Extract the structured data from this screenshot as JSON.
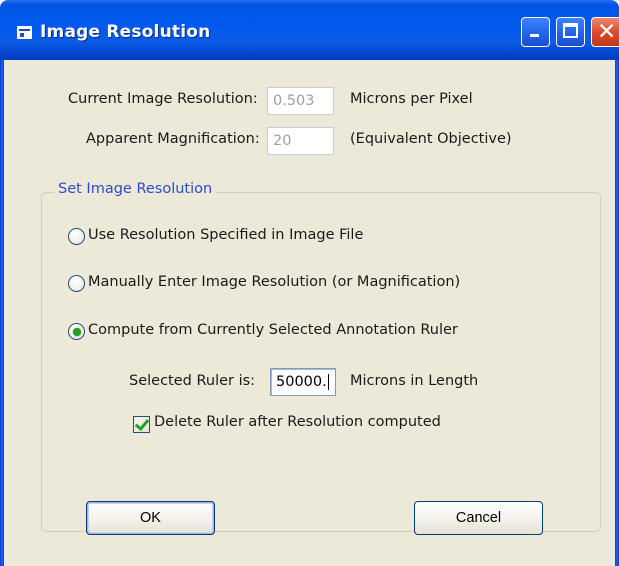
{
  "window": {
    "title": "Image Resolution"
  },
  "current": {
    "label": "Current Image Resolution:",
    "value": "0.503",
    "unit": "Microns per Pixel"
  },
  "apparent": {
    "label": "Apparent Magnification:",
    "value": "20",
    "unit": "(Equivalent Objective)"
  },
  "group": {
    "title": "Set Image Resolution",
    "options": [
      {
        "label": "Use Resolution Specified in Image File",
        "selected": false
      },
      {
        "label": "Manually Enter Image Resolution (or Magnification)",
        "selected": false
      },
      {
        "label": "Compute from Currently Selected Annotation Ruler",
        "selected": true
      }
    ],
    "ruler": {
      "label": "Selected Ruler is:",
      "value": "50000.",
      "unit": "Microns in Length"
    },
    "delete": {
      "label": "Delete Ruler after Resolution computed",
      "checked": true
    }
  },
  "buttons": {
    "ok": "OK",
    "cancel": "Cancel"
  }
}
